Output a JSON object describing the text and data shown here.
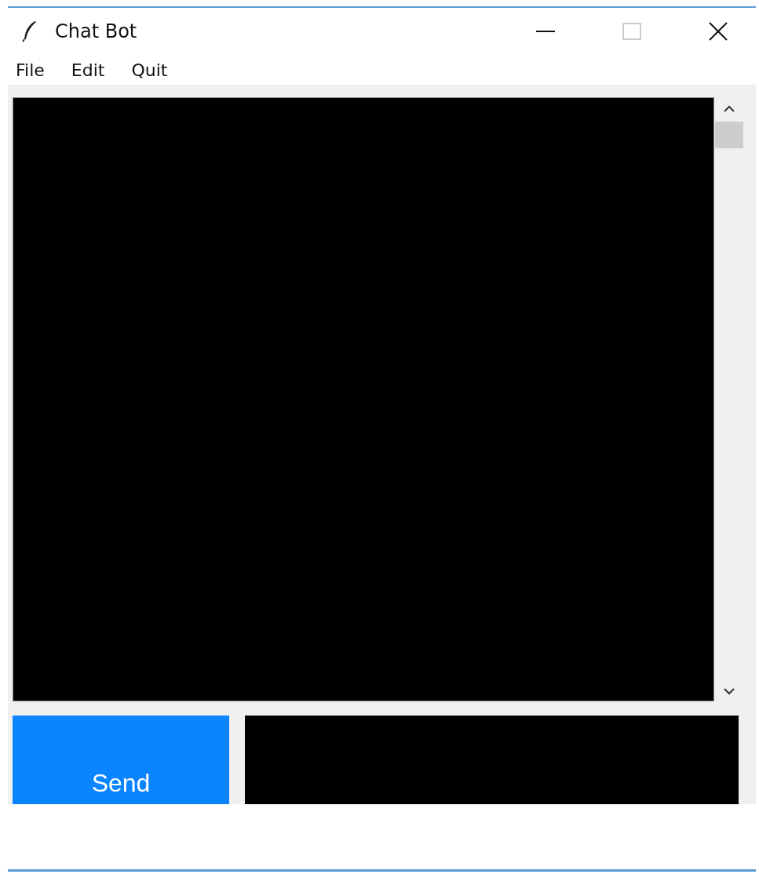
{
  "window": {
    "title": "Chat Bot"
  },
  "menu": [
    "File",
    "Edit",
    "Quit"
  ],
  "send_button": {
    "label": "Send"
  }
}
